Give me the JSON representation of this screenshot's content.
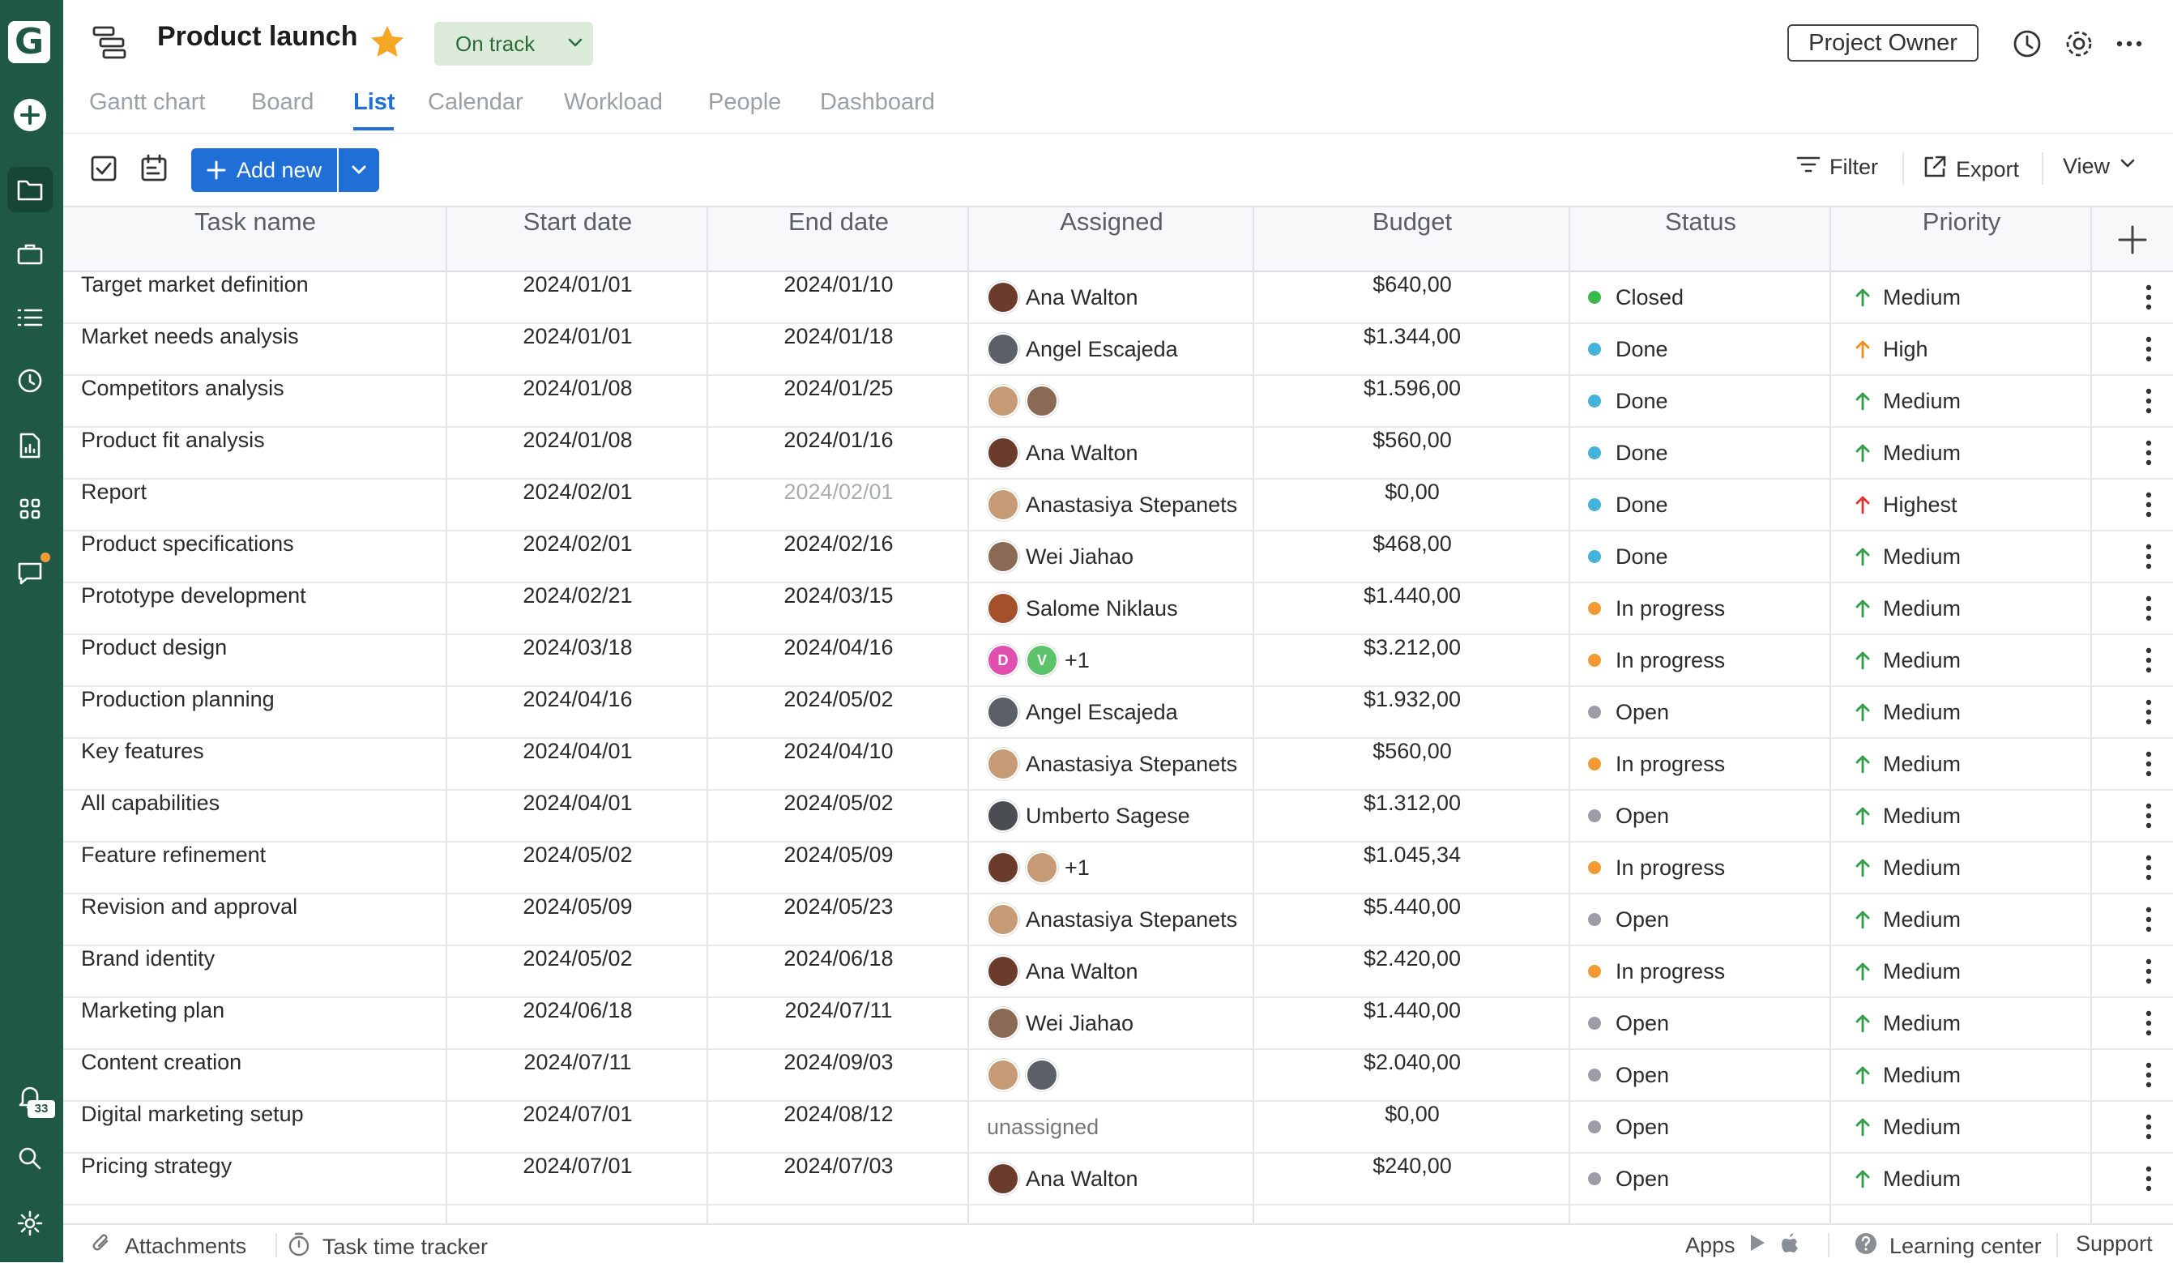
{
  "app": {
    "logo_letter": "G",
    "notification_count": "33"
  },
  "header": {
    "project_title": "Product launch",
    "status_label": "On track",
    "owner_button": "Project Owner"
  },
  "tabs": [
    {
      "label": "Gantt chart",
      "active": false
    },
    {
      "label": "Board",
      "active": false
    },
    {
      "label": "List",
      "active": true
    },
    {
      "label": "Calendar",
      "active": false
    },
    {
      "label": "Workload",
      "active": false
    },
    {
      "label": "People",
      "active": false
    },
    {
      "label": "Dashboard",
      "active": false
    }
  ],
  "toolbar": {
    "add_new": "Add new",
    "filter": "Filter",
    "export": "Export",
    "view": "View"
  },
  "table": {
    "columns": [
      "Task name",
      "Start date",
      "End date",
      "Assigned",
      "Budget",
      "Status",
      "Priority"
    ],
    "rows": [
      {
        "task": "Target market definition",
        "start": "2024/01/01",
        "end": "2024/01/10",
        "assigned": "Ana Walton",
        "avatars": [
          "ana"
        ],
        "budget": "$640,00",
        "status": "Closed",
        "status_color": "#3bb84a",
        "priority": "Medium",
        "priority_color": "#2f9e44"
      },
      {
        "task": "Market needs analysis",
        "start": "2024/01/01",
        "end": "2024/01/18",
        "assigned": "Angel Escajeda",
        "avatars": [
          "angel"
        ],
        "budget": "$1.344,00",
        "status": "Done",
        "status_color": "#45b3d8",
        "priority": "High",
        "priority_color": "#f08c1a"
      },
      {
        "task": "Competitors analysis",
        "start": "2024/01/08",
        "end": "2024/01/25",
        "assigned": "",
        "avatars": [
          "anastasiya",
          "wei"
        ],
        "budget": "$1.596,00",
        "status": "Done",
        "status_color": "#45b3d8",
        "priority": "Medium",
        "priority_color": "#2f9e44"
      },
      {
        "task": "Product fit analysis",
        "start": "2024/01/08",
        "end": "2024/01/16",
        "assigned": "Ana Walton",
        "avatars": [
          "ana"
        ],
        "budget": "$560,00",
        "status": "Done",
        "status_color": "#45b3d8",
        "priority": "Medium",
        "priority_color": "#2f9e44"
      },
      {
        "task": "Report",
        "start": "2024/02/01",
        "end": "2024/02/01",
        "end_muted": true,
        "assigned": "Anastasiya Stepanets",
        "avatars": [
          "anastasiya"
        ],
        "budget": "$0,00",
        "status": "Done",
        "status_color": "#45b3d8",
        "priority": "Highest",
        "priority_color": "#e03131"
      },
      {
        "task": "Product specifications",
        "start": "2024/02/01",
        "end": "2024/02/16",
        "assigned": "Wei Jiahao",
        "avatars": [
          "wei"
        ],
        "budget": "$468,00",
        "status": "Done",
        "status_color": "#45b3d8",
        "priority": "Medium",
        "priority_color": "#2f9e44"
      },
      {
        "task": "Prototype development",
        "start": "2024/02/21",
        "end": "2024/03/15",
        "assigned": "Salome Niklaus",
        "avatars": [
          "salome"
        ],
        "budget": "$1.440,00",
        "status": "In progress",
        "status_color": "#f39a36",
        "priority": "Medium",
        "priority_color": "#2f9e44"
      },
      {
        "task": "Product design",
        "start": "2024/03/18",
        "end": "2024/04/16",
        "assigned": "+1",
        "avatars": [
          "D",
          "V"
        ],
        "budget": "$3.212,00",
        "status": "In progress",
        "status_color": "#f39a36",
        "priority": "Medium",
        "priority_color": "#2f9e44"
      },
      {
        "task": "Production planning",
        "start": "2024/04/16",
        "end": "2024/05/02",
        "assigned": "Angel Escajeda",
        "avatars": [
          "angel"
        ],
        "budget": "$1.932,00",
        "status": "Open",
        "status_color": "#9a9ea3",
        "priority": "Medium",
        "priority_color": "#2f9e44"
      },
      {
        "task": "Key features",
        "start": "2024/04/01",
        "end": "2024/04/10",
        "assigned": "Anastasiya Stepanets",
        "avatars": [
          "anastasiya"
        ],
        "budget": "$560,00",
        "status": "In progress",
        "status_color": "#f39a36",
        "priority": "Medium",
        "priority_color": "#2f9e44"
      },
      {
        "task": "All capabilities",
        "start": "2024/04/01",
        "end": "2024/05/02",
        "assigned": "Umberto Sagese",
        "avatars": [
          "umberto"
        ],
        "budget": "$1.312,00",
        "status": "Open",
        "status_color": "#9a9ea3",
        "priority": "Medium",
        "priority_color": "#2f9e44"
      },
      {
        "task": "Feature refinement",
        "start": "2024/05/02",
        "end": "2024/05/09",
        "assigned": "+1",
        "avatars": [
          "ana",
          "anastasiya"
        ],
        "budget": "$1.045,34",
        "status": "In progress",
        "status_color": "#f39a36",
        "priority": "Medium",
        "priority_color": "#2f9e44"
      },
      {
        "task": "Revision and approval",
        "start": "2024/05/09",
        "end": "2024/05/23",
        "assigned": "Anastasiya Stepanets",
        "avatars": [
          "anastasiya"
        ],
        "budget": "$5.440,00",
        "status": "Open",
        "status_color": "#9a9ea3",
        "priority": "Medium",
        "priority_color": "#2f9e44"
      },
      {
        "task": "Brand identity",
        "start": "2024/05/02",
        "end": "2024/06/18",
        "assigned": "Ana Walton",
        "avatars": [
          "ana"
        ],
        "budget": "$2.420,00",
        "status": "In progress",
        "status_color": "#f39a36",
        "priority": "Medium",
        "priority_color": "#2f9e44"
      },
      {
        "task": "Marketing plan",
        "start": "2024/06/18",
        "end": "2024/07/11",
        "assigned": "Wei Jiahao",
        "avatars": [
          "wei"
        ],
        "budget": "$1.440,00",
        "status": "Open",
        "status_color": "#9a9ea3",
        "priority": "Medium",
        "priority_color": "#2f9e44"
      },
      {
        "task": "Content creation",
        "start": "2024/07/11",
        "end": "2024/09/03",
        "assigned": "",
        "avatars": [
          "anastasiya",
          "angel"
        ],
        "budget": "$2.040,00",
        "status": "Open",
        "status_color": "#9a9ea3",
        "priority": "Medium",
        "priority_color": "#2f9e44"
      },
      {
        "task": "Digital marketing setup",
        "start": "2024/07/01",
        "end": "2024/08/12",
        "assigned": "unassigned",
        "assigned_muted": true,
        "avatars": [],
        "budget": "$0,00",
        "status": "Open",
        "status_color": "#9a9ea3",
        "priority": "Medium",
        "priority_color": "#2f9e44"
      },
      {
        "task": "Pricing strategy",
        "start": "2024/07/01",
        "end": "2024/07/03",
        "assigned": "Ana Walton",
        "avatars": [
          "ana"
        ],
        "budget": "$240,00",
        "status": "Open",
        "status_color": "#9a9ea3",
        "priority": "Medium",
        "priority_color": "#2f9e44"
      }
    ]
  },
  "footer": {
    "attachments": "Attachments",
    "time_tracker": "Task time tracker",
    "apps": "Apps",
    "learning": "Learning center",
    "support": "Support"
  },
  "colors": {
    "rail": "#1f5845",
    "accent": "#1f6fd6",
    "star": "#f5a623"
  }
}
